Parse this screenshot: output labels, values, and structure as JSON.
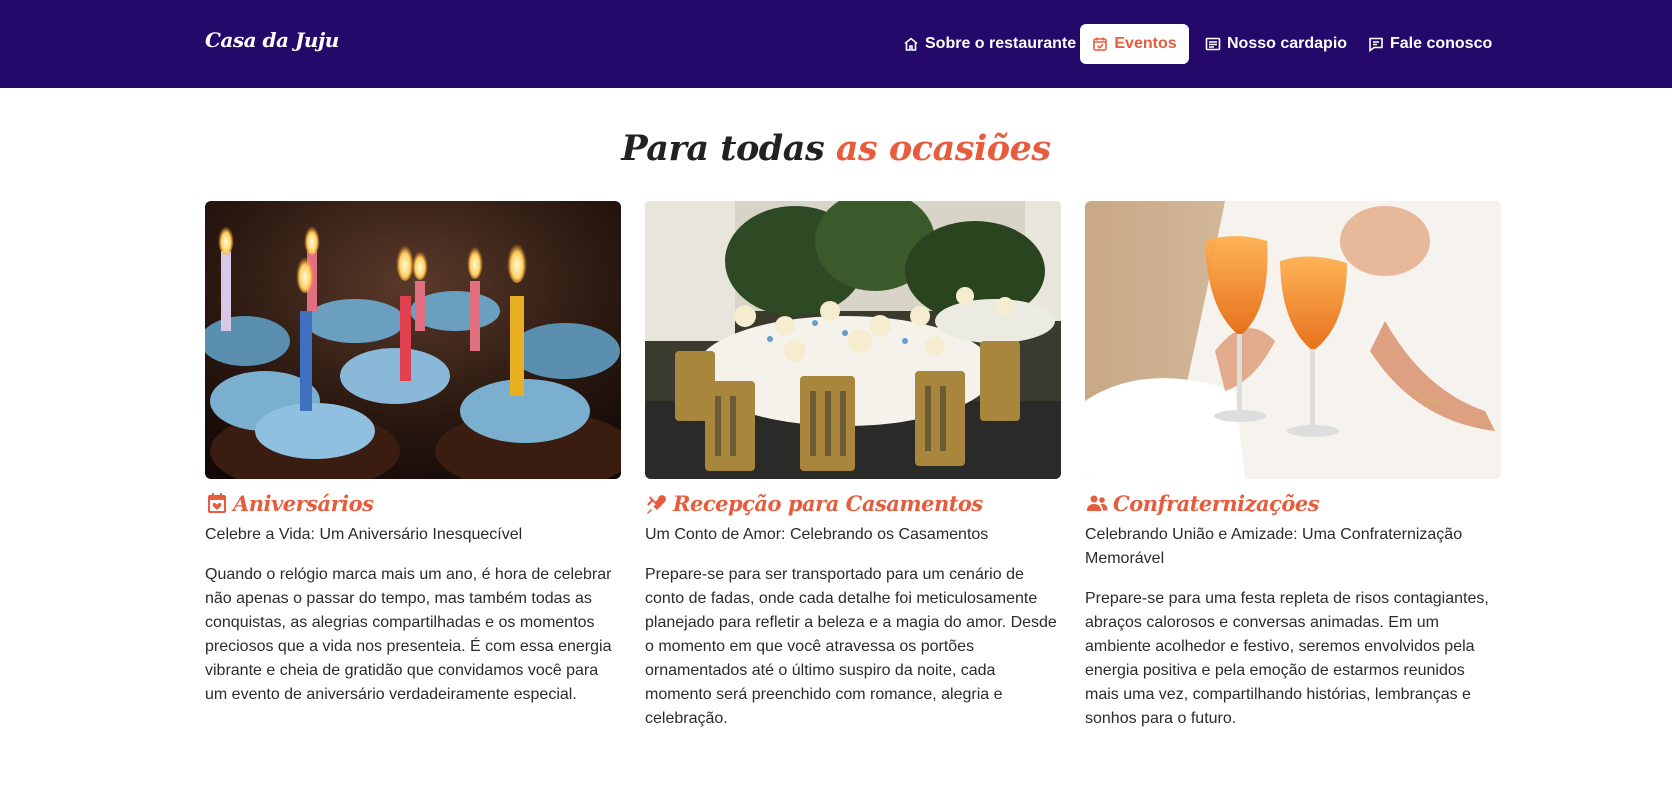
{
  "brand": "Casa da Juju",
  "nav": {
    "items": [
      {
        "label": "Sobre o restaurante",
        "icon": "home-icon"
      },
      {
        "label": "Eventos",
        "icon": "calendar-check-icon",
        "active": true
      },
      {
        "label": "Nosso cardapio",
        "icon": "menu-card-icon"
      },
      {
        "label": "Fale conosco",
        "icon": "chat-icon"
      }
    ]
  },
  "section": {
    "title_main": "Para todas",
    "title_accent": "as ocasiões"
  },
  "cards": [
    {
      "icon": "calendar-heart-icon",
      "title": "Aniversários",
      "subtitle": "Celebre a Vida: Um Aniversário Inesquecível",
      "body": "Quando o relógio marca mais um ano, é hora de celebrar não apenas o passar do tempo, mas também todas as conquistas, as alegrias compartilhadas e os momentos preciosos que a vida nos presenteia. É com essa energia vibrante e cheia de gratidão que convidamos você para um evento de aniversário verdadeiramente especial."
    },
    {
      "icon": "cupid-heart-icon",
      "title": "Recepção para Casamentos",
      "subtitle": "Um Conto de Amor: Celebrando os Casamentos",
      "body": "Prepare-se para ser transportado para um cenário de conto de fadas, onde cada detalhe foi meticulosamente planejado para refletir a beleza e a magia do amor. Desde o momento em que você atravessa os portões ornamentados até o último suspiro da noite, cada momento será preenchido com romance, alegria e celebração."
    },
    {
      "icon": "people-icon",
      "title": "Confraternizações",
      "subtitle": "Celebrando União e Amizade: Uma Confraternização Memorável",
      "body": "Prepare-se para uma festa repleta de risos contagiantes, abraços calorosos e conversas animadas. Em um ambiente acolhedor e festivo, seremos envolvidos pela energia positiva e pela emoção de estarmos reunidos mais uma vez, compartilhando histórias, lembranças e sonhos para o futuro."
    }
  ],
  "colors": {
    "navbar": "#24096a",
    "accent": "#e65c3c",
    "text": "#2b2b2b"
  }
}
